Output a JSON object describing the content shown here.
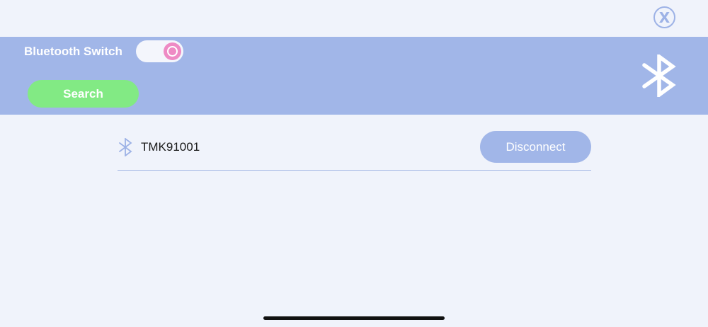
{
  "close": {
    "label": "X"
  },
  "bluetooth": {
    "switch_label": "Bluetooth Switch",
    "switch_on": true,
    "search_label": "Search"
  },
  "devices": [
    {
      "name": "TMK91001",
      "action_label": "Disconnect"
    }
  ],
  "icons": {
    "close": "close-icon",
    "header": "bluetooth-icon",
    "device": "bluetooth-icon"
  },
  "colors": {
    "background": "#f0f3fb",
    "header_band": "#a1b6e8",
    "toggle_knob": "#ee8ac4",
    "search_button": "#82ea84",
    "disconnect_button": "#a1b6e8",
    "accent_line": "#a3b6e4"
  }
}
